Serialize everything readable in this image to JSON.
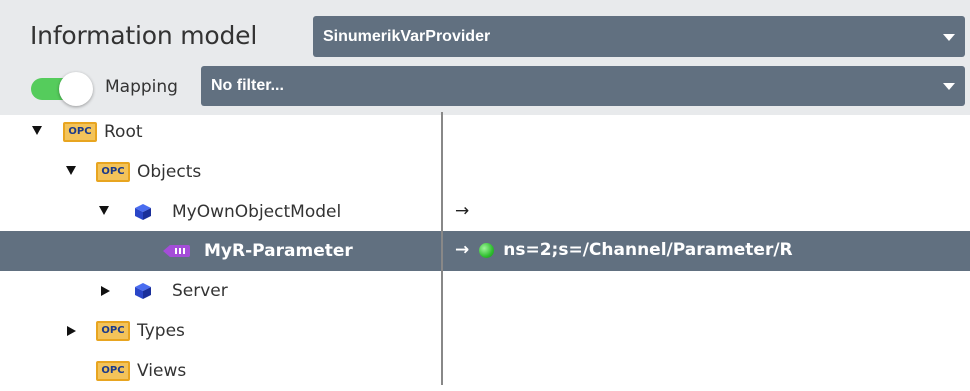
{
  "header": {
    "title": "Information model",
    "provider_select": {
      "value": "SinumerikVarProvider"
    },
    "mapping_toggle": {
      "label": "Mapping",
      "on": true
    },
    "filter_select": {
      "value": "No filter..."
    }
  },
  "tree": {
    "rows": [
      {
        "name": "Root",
        "icon": "opc-folder-icon",
        "expander": "expanded",
        "mapping": ""
      },
      {
        "name": "Objects",
        "icon": "opc-folder-icon",
        "expander": "expanded",
        "mapping": ""
      },
      {
        "name": "MyOwnObjectModel",
        "icon": "object-cube-icon",
        "expander": "expanded",
        "mapping_arrow": "→",
        "mapping": ""
      },
      {
        "name": "MyR-Parameter",
        "icon": "variable-icon",
        "selected": true,
        "mapping_arrow": "→",
        "mapping": "ns=2;s=/Channel/Parameter/R",
        "status": "connected"
      },
      {
        "name": "Server",
        "icon": "object-cube-icon",
        "expander": "collapsed",
        "mapping": ""
      },
      {
        "name": "Types",
        "icon": "opc-folder-icon",
        "expander": "collapsed",
        "mapping": ""
      },
      {
        "name": "Views",
        "icon": "opc-folder-icon",
        "mapping": ""
      }
    ],
    "opc_icon_text": "OPC"
  },
  "colors": {
    "header_bg": "#e8eaec",
    "select_bg": "#617080",
    "toggle_on": "#55cc5c",
    "selected_row_bg": "#617080",
    "status_green": "#2fbf2f"
  }
}
